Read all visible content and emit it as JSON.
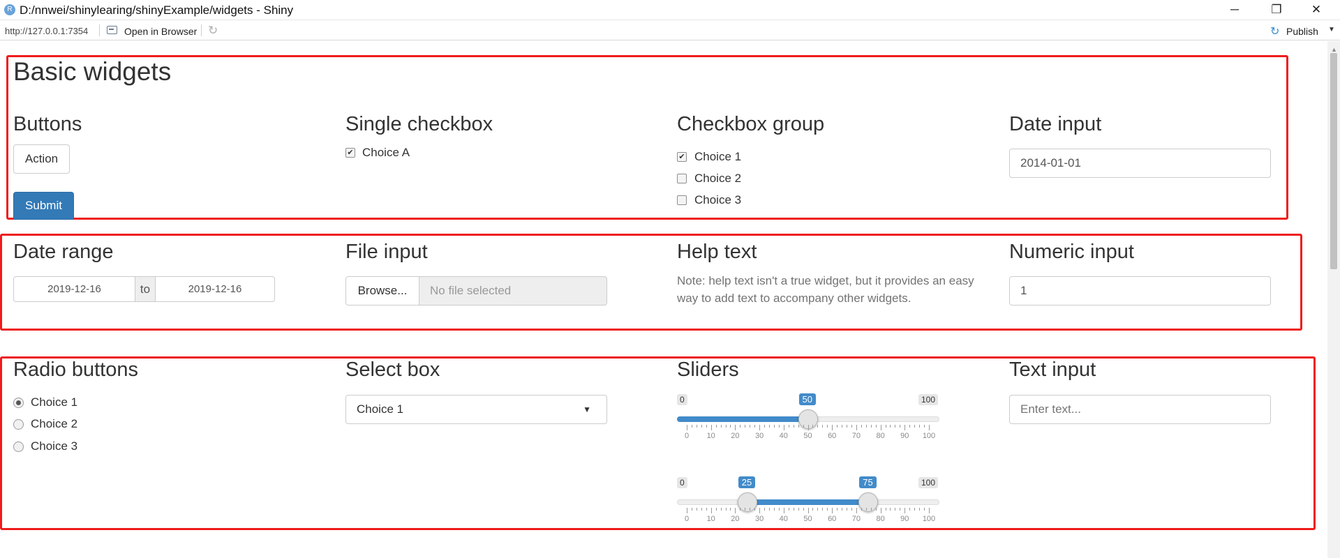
{
  "window": {
    "title": "D:/nnwei/shinylearing/shinyExample/widgets - Shiny",
    "app_icon_letter": "R",
    "minimize": "─",
    "maximize": "❐",
    "close": "✕"
  },
  "toolbar": {
    "url": "http://127.0.0.1:7354",
    "open_browser": "Open in Browser",
    "publish": "Publish",
    "publish_icon": "↻",
    "refresh_icon": "↻",
    "caret": "▼"
  },
  "page": {
    "title": "Basic widgets",
    "buttons": {
      "heading": "Buttons",
      "action": "Action",
      "submit": "Submit"
    },
    "single_checkbox": {
      "heading": "Single checkbox",
      "label": "Choice A",
      "checked": true
    },
    "checkbox_group": {
      "heading": "Checkbox group",
      "options": [
        {
          "label": "Choice 1",
          "checked": true
        },
        {
          "label": "Choice 2",
          "checked": false
        },
        {
          "label": "Choice 3",
          "checked": false
        }
      ]
    },
    "date_input": {
      "heading": "Date input",
      "value": "2014-01-01"
    },
    "date_range": {
      "heading": "Date range",
      "start": "2019-12-16",
      "separator": "to",
      "end": "2019-12-16"
    },
    "file_input": {
      "heading": "File input",
      "browse": "Browse...",
      "placeholder": "No file selected"
    },
    "help_text": {
      "heading": "Help text",
      "text": "Note: help text isn't a true widget, but it provides an easy way to add text to accompany other widgets."
    },
    "numeric_input": {
      "heading": "Numeric input",
      "value": "1"
    },
    "radio_buttons": {
      "heading": "Radio buttons",
      "options": [
        {
          "label": "Choice 1",
          "selected": true
        },
        {
          "label": "Choice 2",
          "selected": false
        },
        {
          "label": "Choice 3",
          "selected": false
        }
      ]
    },
    "select_box": {
      "heading": "Select box",
      "selected": "Choice 1",
      "caret": "▼"
    },
    "sliders": {
      "heading": "Sliders",
      "min": 0,
      "max": 100,
      "min_label": "0",
      "max_label": "100",
      "ticks": [
        "0",
        "10",
        "20",
        "30",
        "40",
        "50",
        "60",
        "70",
        "80",
        "90",
        "100"
      ],
      "slider1": {
        "value": 50,
        "value_label": "50"
      },
      "slider2": {
        "from": 25,
        "to": 75,
        "from_label": "25",
        "to_label": "75"
      }
    },
    "text_input": {
      "heading": "Text input",
      "placeholder": "Enter text..."
    }
  },
  "colors": {
    "annotation_red": "#ee1c1c",
    "primary": "#337ab7",
    "slider_blue": "#428bca"
  }
}
